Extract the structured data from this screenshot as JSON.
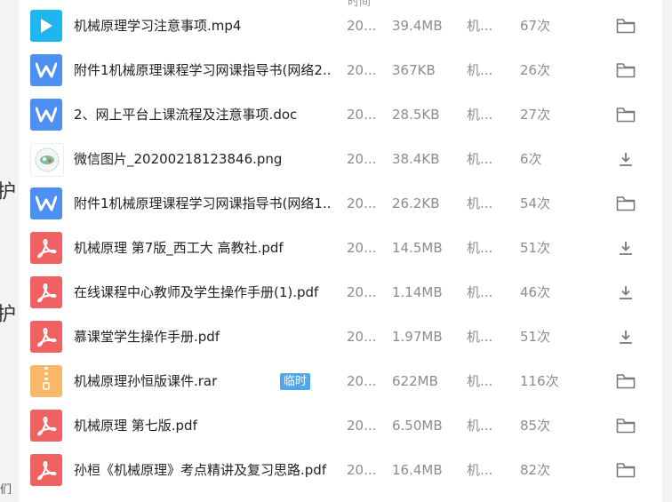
{
  "header_fragment": "时间",
  "edge_chars": [
    "护",
    "护",
    "们"
  ],
  "files": [
    {
      "icon": "video-file-icon",
      "name": "机械原理学习注意事项.mp4",
      "tag": "",
      "date": "20...",
      "size": "39.4MB",
      "source": "机...",
      "count": "67次",
      "action": "folder-icon"
    },
    {
      "icon": "word-file-icon",
      "name": "附件1机械原理课程学习网课指导书(网络2...",
      "tag": "",
      "date": "20...",
      "size": "367KB",
      "source": "机...",
      "count": "26次",
      "action": "folder-icon"
    },
    {
      "icon": "word-file-icon",
      "name": "2、网上平台上课流程及注意事项.doc",
      "tag": "",
      "date": "20...",
      "size": "28.5KB",
      "source": "机...",
      "count": "27次",
      "action": "folder-icon"
    },
    {
      "icon": "image-thumbnail-icon",
      "name": "微信图片_20200218123846.png",
      "tag": "",
      "date": "20...",
      "size": "38.4KB",
      "source": "机...",
      "count": "6次",
      "action": "download-icon"
    },
    {
      "icon": "word-file-icon",
      "name": "附件1机械原理课程学习网课指导书(网络1...",
      "tag": "",
      "date": "20...",
      "size": "26.2KB",
      "source": "机...",
      "count": "54次",
      "action": "folder-icon"
    },
    {
      "icon": "pdf-file-icon",
      "name": "机械原理 第7版_西工大 高教社.pdf",
      "tag": "",
      "date": "20...",
      "size": "14.5MB",
      "source": "机...",
      "count": "51次",
      "action": "download-icon"
    },
    {
      "icon": "pdf-file-icon",
      "name": "在线课程中心教师及学生操作手册(1).pdf",
      "tag": "",
      "date": "20...",
      "size": "1.14MB",
      "source": "机...",
      "count": "46次",
      "action": "download-icon"
    },
    {
      "icon": "pdf-file-icon",
      "name": "慕课堂学生操作手册.pdf",
      "tag": "",
      "date": "20...",
      "size": "1.97MB",
      "source": "机...",
      "count": "51次",
      "action": "download-icon"
    },
    {
      "icon": "archive-file-icon",
      "name": "机械原理孙恒版课件.rar",
      "tag": "临时",
      "date": "20...",
      "size": "622MB",
      "source": "机...",
      "count": "116次",
      "action": "folder-icon"
    },
    {
      "icon": "pdf-file-icon",
      "name": "机械原理 第七版.pdf",
      "tag": "",
      "date": "20...",
      "size": "6.50MB",
      "source": "机...",
      "count": "85次",
      "action": "folder-icon"
    },
    {
      "icon": "pdf-file-icon",
      "name": "孙桓《机械原理》考点精讲及复习思路.pdf",
      "tag": "",
      "date": "20...",
      "size": "16.4MB",
      "source": "机...",
      "count": "82次",
      "action": "folder-icon"
    }
  ],
  "colors": {
    "video": "#1eb6f0",
    "word": "#4d8ff2",
    "pdf": "#f06262",
    "archive": "#f7b868",
    "tag": "#4fa8ef",
    "muted_text": "#8c8c8c"
  }
}
